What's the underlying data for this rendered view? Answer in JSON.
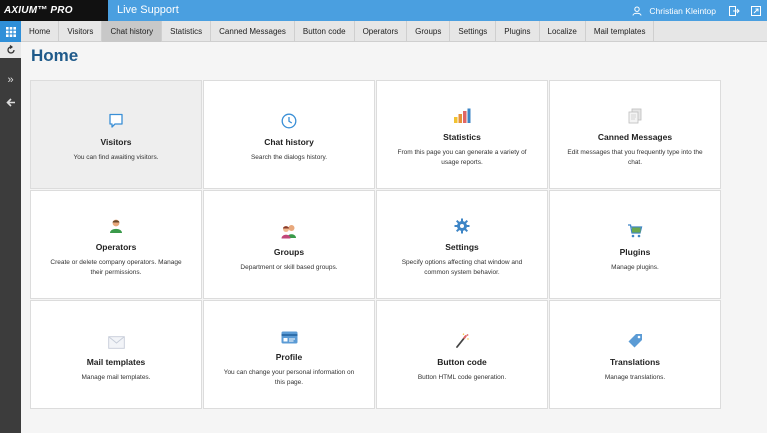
{
  "header": {
    "logo": "AXIUM™ PRO",
    "app_title": "Live Support",
    "user_name": "Christian Kleintop"
  },
  "tabs": [
    {
      "label": "Home"
    },
    {
      "label": "Visitors"
    },
    {
      "label": "Chat history"
    },
    {
      "label": "Statistics"
    },
    {
      "label": "Canned Messages"
    },
    {
      "label": "Button code"
    },
    {
      "label": "Operators"
    },
    {
      "label": "Groups"
    },
    {
      "label": "Settings"
    },
    {
      "label": "Plugins"
    },
    {
      "label": "Localize"
    },
    {
      "label": "Mail templates"
    }
  ],
  "active_tab": "Chat history",
  "page_title": "Home",
  "cards": [
    {
      "title": "Visitors",
      "desc": "You can find awaiting visitors.",
      "icon": "chat-bubble-icon"
    },
    {
      "title": "Chat history",
      "desc": "Search the dialogs history.",
      "icon": "clock-icon"
    },
    {
      "title": "Statistics",
      "desc": "From this page you can generate a variety of usage reports.",
      "icon": "bar-chart-icon"
    },
    {
      "title": "Canned Messages",
      "desc": "Edit messages that you frequently type into the chat.",
      "icon": "documents-icon"
    },
    {
      "title": "Operators",
      "desc": "Create or delete company operators. Manage their permissions.",
      "icon": "operator-icon"
    },
    {
      "title": "Groups",
      "desc": "Department or skill based groups.",
      "icon": "group-icon"
    },
    {
      "title": "Settings",
      "desc": "Specify options affecting chat window and common system behavior.",
      "icon": "gear-icon"
    },
    {
      "title": "Plugins",
      "desc": "Manage plugins.",
      "icon": "cart-icon"
    },
    {
      "title": "Mail templates",
      "desc": "Manage mail templates.",
      "icon": "envelope-icon"
    },
    {
      "title": "Profile",
      "desc": "You can change your personal information on this page.",
      "icon": "id-card-icon"
    },
    {
      "title": "Button code",
      "desc": "Button HTML code generation.",
      "icon": "magic-wand-icon"
    },
    {
      "title": "Translations",
      "desc": "Manage translations.",
      "icon": "tag-icon"
    }
  ],
  "colors": {
    "header_blue": "#4a9fe0",
    "title_blue": "#1f5a8a",
    "rail_dark": "#3c3c3c"
  }
}
